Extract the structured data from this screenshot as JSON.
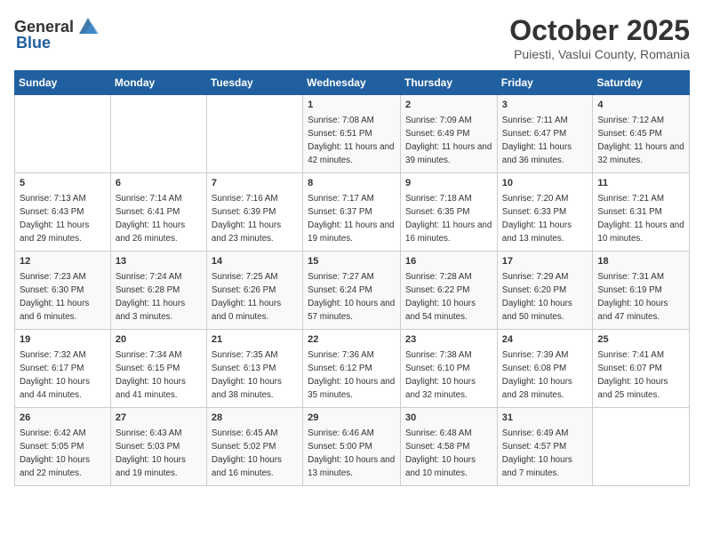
{
  "header": {
    "logo_general": "General",
    "logo_blue": "Blue",
    "month": "October 2025",
    "location": "Puiesti, Vaslui County, Romania"
  },
  "days_of_week": [
    "Sunday",
    "Monday",
    "Tuesday",
    "Wednesday",
    "Thursday",
    "Friday",
    "Saturday"
  ],
  "weeks": [
    [
      {
        "day": "",
        "sunrise": "",
        "sunset": "",
        "daylight": ""
      },
      {
        "day": "",
        "sunrise": "",
        "sunset": "",
        "daylight": ""
      },
      {
        "day": "",
        "sunrise": "",
        "sunset": "",
        "daylight": ""
      },
      {
        "day": "1",
        "sunrise": "Sunrise: 7:08 AM",
        "sunset": "Sunset: 6:51 PM",
        "daylight": "Daylight: 11 hours and 42 minutes."
      },
      {
        "day": "2",
        "sunrise": "Sunrise: 7:09 AM",
        "sunset": "Sunset: 6:49 PM",
        "daylight": "Daylight: 11 hours and 39 minutes."
      },
      {
        "day": "3",
        "sunrise": "Sunrise: 7:11 AM",
        "sunset": "Sunset: 6:47 PM",
        "daylight": "Daylight: 11 hours and 36 minutes."
      },
      {
        "day": "4",
        "sunrise": "Sunrise: 7:12 AM",
        "sunset": "Sunset: 6:45 PM",
        "daylight": "Daylight: 11 hours and 32 minutes."
      }
    ],
    [
      {
        "day": "5",
        "sunrise": "Sunrise: 7:13 AM",
        "sunset": "Sunset: 6:43 PM",
        "daylight": "Daylight: 11 hours and 29 minutes."
      },
      {
        "day": "6",
        "sunrise": "Sunrise: 7:14 AM",
        "sunset": "Sunset: 6:41 PM",
        "daylight": "Daylight: 11 hours and 26 minutes."
      },
      {
        "day": "7",
        "sunrise": "Sunrise: 7:16 AM",
        "sunset": "Sunset: 6:39 PM",
        "daylight": "Daylight: 11 hours and 23 minutes."
      },
      {
        "day": "8",
        "sunrise": "Sunrise: 7:17 AM",
        "sunset": "Sunset: 6:37 PM",
        "daylight": "Daylight: 11 hours and 19 minutes."
      },
      {
        "day": "9",
        "sunrise": "Sunrise: 7:18 AM",
        "sunset": "Sunset: 6:35 PM",
        "daylight": "Daylight: 11 hours and 16 minutes."
      },
      {
        "day": "10",
        "sunrise": "Sunrise: 7:20 AM",
        "sunset": "Sunset: 6:33 PM",
        "daylight": "Daylight: 11 hours and 13 minutes."
      },
      {
        "day": "11",
        "sunrise": "Sunrise: 7:21 AM",
        "sunset": "Sunset: 6:31 PM",
        "daylight": "Daylight: 11 hours and 10 minutes."
      }
    ],
    [
      {
        "day": "12",
        "sunrise": "Sunrise: 7:23 AM",
        "sunset": "Sunset: 6:30 PM",
        "daylight": "Daylight: 11 hours and 6 minutes."
      },
      {
        "day": "13",
        "sunrise": "Sunrise: 7:24 AM",
        "sunset": "Sunset: 6:28 PM",
        "daylight": "Daylight: 11 hours and 3 minutes."
      },
      {
        "day": "14",
        "sunrise": "Sunrise: 7:25 AM",
        "sunset": "Sunset: 6:26 PM",
        "daylight": "Daylight: 11 hours and 0 minutes."
      },
      {
        "day": "15",
        "sunrise": "Sunrise: 7:27 AM",
        "sunset": "Sunset: 6:24 PM",
        "daylight": "Daylight: 10 hours and 57 minutes."
      },
      {
        "day": "16",
        "sunrise": "Sunrise: 7:28 AM",
        "sunset": "Sunset: 6:22 PM",
        "daylight": "Daylight: 10 hours and 54 minutes."
      },
      {
        "day": "17",
        "sunrise": "Sunrise: 7:29 AM",
        "sunset": "Sunset: 6:20 PM",
        "daylight": "Daylight: 10 hours and 50 minutes."
      },
      {
        "day": "18",
        "sunrise": "Sunrise: 7:31 AM",
        "sunset": "Sunset: 6:19 PM",
        "daylight": "Daylight: 10 hours and 47 minutes."
      }
    ],
    [
      {
        "day": "19",
        "sunrise": "Sunrise: 7:32 AM",
        "sunset": "Sunset: 6:17 PM",
        "daylight": "Daylight: 10 hours and 44 minutes."
      },
      {
        "day": "20",
        "sunrise": "Sunrise: 7:34 AM",
        "sunset": "Sunset: 6:15 PM",
        "daylight": "Daylight: 10 hours and 41 minutes."
      },
      {
        "day": "21",
        "sunrise": "Sunrise: 7:35 AM",
        "sunset": "Sunset: 6:13 PM",
        "daylight": "Daylight: 10 hours and 38 minutes."
      },
      {
        "day": "22",
        "sunrise": "Sunrise: 7:36 AM",
        "sunset": "Sunset: 6:12 PM",
        "daylight": "Daylight: 10 hours and 35 minutes."
      },
      {
        "day": "23",
        "sunrise": "Sunrise: 7:38 AM",
        "sunset": "Sunset: 6:10 PM",
        "daylight": "Daylight: 10 hours and 32 minutes."
      },
      {
        "day": "24",
        "sunrise": "Sunrise: 7:39 AM",
        "sunset": "Sunset: 6:08 PM",
        "daylight": "Daylight: 10 hours and 28 minutes."
      },
      {
        "day": "25",
        "sunrise": "Sunrise: 7:41 AM",
        "sunset": "Sunset: 6:07 PM",
        "daylight": "Daylight: 10 hours and 25 minutes."
      }
    ],
    [
      {
        "day": "26",
        "sunrise": "Sunrise: 6:42 AM",
        "sunset": "Sunset: 5:05 PM",
        "daylight": "Daylight: 10 hours and 22 minutes."
      },
      {
        "day": "27",
        "sunrise": "Sunrise: 6:43 AM",
        "sunset": "Sunset: 5:03 PM",
        "daylight": "Daylight: 10 hours and 19 minutes."
      },
      {
        "day": "28",
        "sunrise": "Sunrise: 6:45 AM",
        "sunset": "Sunset: 5:02 PM",
        "daylight": "Daylight: 10 hours and 16 minutes."
      },
      {
        "day": "29",
        "sunrise": "Sunrise: 6:46 AM",
        "sunset": "Sunset: 5:00 PM",
        "daylight": "Daylight: 10 hours and 13 minutes."
      },
      {
        "day": "30",
        "sunrise": "Sunrise: 6:48 AM",
        "sunset": "Sunset: 4:58 PM",
        "daylight": "Daylight: 10 hours and 10 minutes."
      },
      {
        "day": "31",
        "sunrise": "Sunrise: 6:49 AM",
        "sunset": "Sunset: 4:57 PM",
        "daylight": "Daylight: 10 hours and 7 minutes."
      },
      {
        "day": "",
        "sunrise": "",
        "sunset": "",
        "daylight": ""
      }
    ]
  ]
}
